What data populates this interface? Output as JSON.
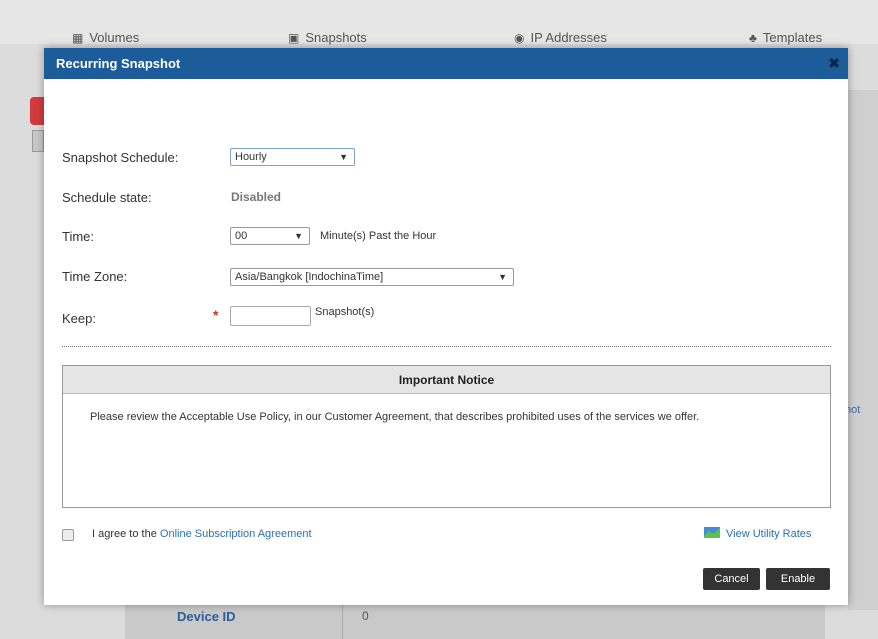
{
  "background": {
    "tabs": [
      {
        "label": "Volumes",
        "icon": "volumes-icon"
      },
      {
        "label": "Snapshots",
        "icon": "camera-icon"
      },
      {
        "label": "IP Addresses",
        "icon": "ip-icon"
      },
      {
        "label": "Templates",
        "icon": "templates-icon"
      }
    ],
    "right_text": "hot",
    "bottom_row": {
      "label": "Device ID",
      "value": "0"
    }
  },
  "dialog": {
    "title": "Recurring Snapshot",
    "close_label": "✖",
    "fields": {
      "schedule_label": "Snapshot Schedule:",
      "schedule_value": "Hourly",
      "state_label": "Schedule state:",
      "state_value": "Disabled",
      "time_label": "Time:",
      "time_value": "00",
      "time_suffix": "Minute(s) Past the Hour",
      "timezone_label": "Time Zone:",
      "timezone_value": "Asia/Bangkok [IndochinaTime]",
      "keep_label": "Keep:",
      "keep_required": "*",
      "keep_value": "",
      "keep_suffix": "Snapshot(s)"
    },
    "notice": {
      "heading": "Important Notice",
      "body": "Please review the Acceptable Use Policy, in our Customer Agreement, that describes prohibited uses of the services we offer."
    },
    "agreement": {
      "prefix": "I agree to the ",
      "link": "Online Subscription Agreement",
      "checked": false
    },
    "utility_link": "View Utility Rates",
    "buttons": {
      "cancel": "Cancel",
      "enable": "Enable"
    }
  },
  "colors": {
    "header": "#1d5c9b",
    "link": "#2a6fb6",
    "button": "#333333",
    "required": "#c0392b"
  }
}
